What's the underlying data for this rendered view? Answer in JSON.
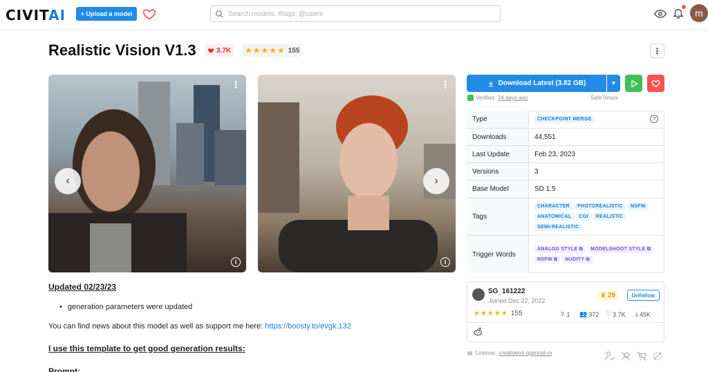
{
  "header": {
    "logo_main": "CIVIT",
    "logo_ai": "AI",
    "upload_label": "+ Upload a model",
    "search_placeholder": "Search models, #tags, @users",
    "avatar_letter": "m"
  },
  "model": {
    "title": "Realistic Vision V1.3",
    "likes": "3.7K",
    "rating_stars": "★★★★★",
    "rating_count": "155"
  },
  "images": [
    {
      "alt": "portrait-man"
    },
    {
      "alt": "portrait-woman"
    }
  ],
  "description": {
    "updated": "Updated 02/23/23",
    "bullet": "generation parameters were updated",
    "news_text": "You can find news about this model as well as support me here: ",
    "news_link": "https://boosty.to/evgk.132",
    "template_heading": "I use this template to get good generation results:",
    "prompt_heading": "Prompt:"
  },
  "sidebar": {
    "download_label": "Download Latest (3.82 GB)",
    "verified_prefix": "Verified:",
    "verified_date": "24 days ago",
    "safetensor": "SafeTensor",
    "rows": {
      "type_label": "Type",
      "type_value": "CHECKPOINT MERGE",
      "downloads_label": "Downloads",
      "downloads_value": "44,551",
      "last_update_label": "Last Update",
      "last_update_value": "Feb 23, 2023",
      "versions_label": "Versions",
      "versions_value": "3",
      "base_model_label": "Base Model",
      "base_model_value": "SD 1.5",
      "tags_label": "Tags",
      "trigger_label": "Trigger Words"
    },
    "tags": [
      "CHARACTER",
      "PHOTOREALISTIC",
      "NSFW",
      "ANATOMICAL",
      "CGI",
      "REALISTIC",
      "SEMI-REALISTIC"
    ],
    "trigger_words": [
      "ANALOG STYLE",
      "MODELSHOOT STYLE",
      "NSFW",
      "NUDITY"
    ]
  },
  "creator": {
    "name": "SG_161222",
    "joined": "Joined Dec 22, 2022",
    "crown_count": "29",
    "unfollow_label": "Unfollow",
    "rating_stars": "★★★★★",
    "rating_count": "155",
    "uploads": "1",
    "followers": "372",
    "likes": "3.7K",
    "downloads": "45K"
  },
  "license": {
    "prefix": "License:",
    "name": "creativeml-openrail-m"
  },
  "colors": {
    "brand_blue": "#228be6",
    "like_red": "#e03131",
    "play_green": "#40c057",
    "star_yellow": "#fab005"
  }
}
